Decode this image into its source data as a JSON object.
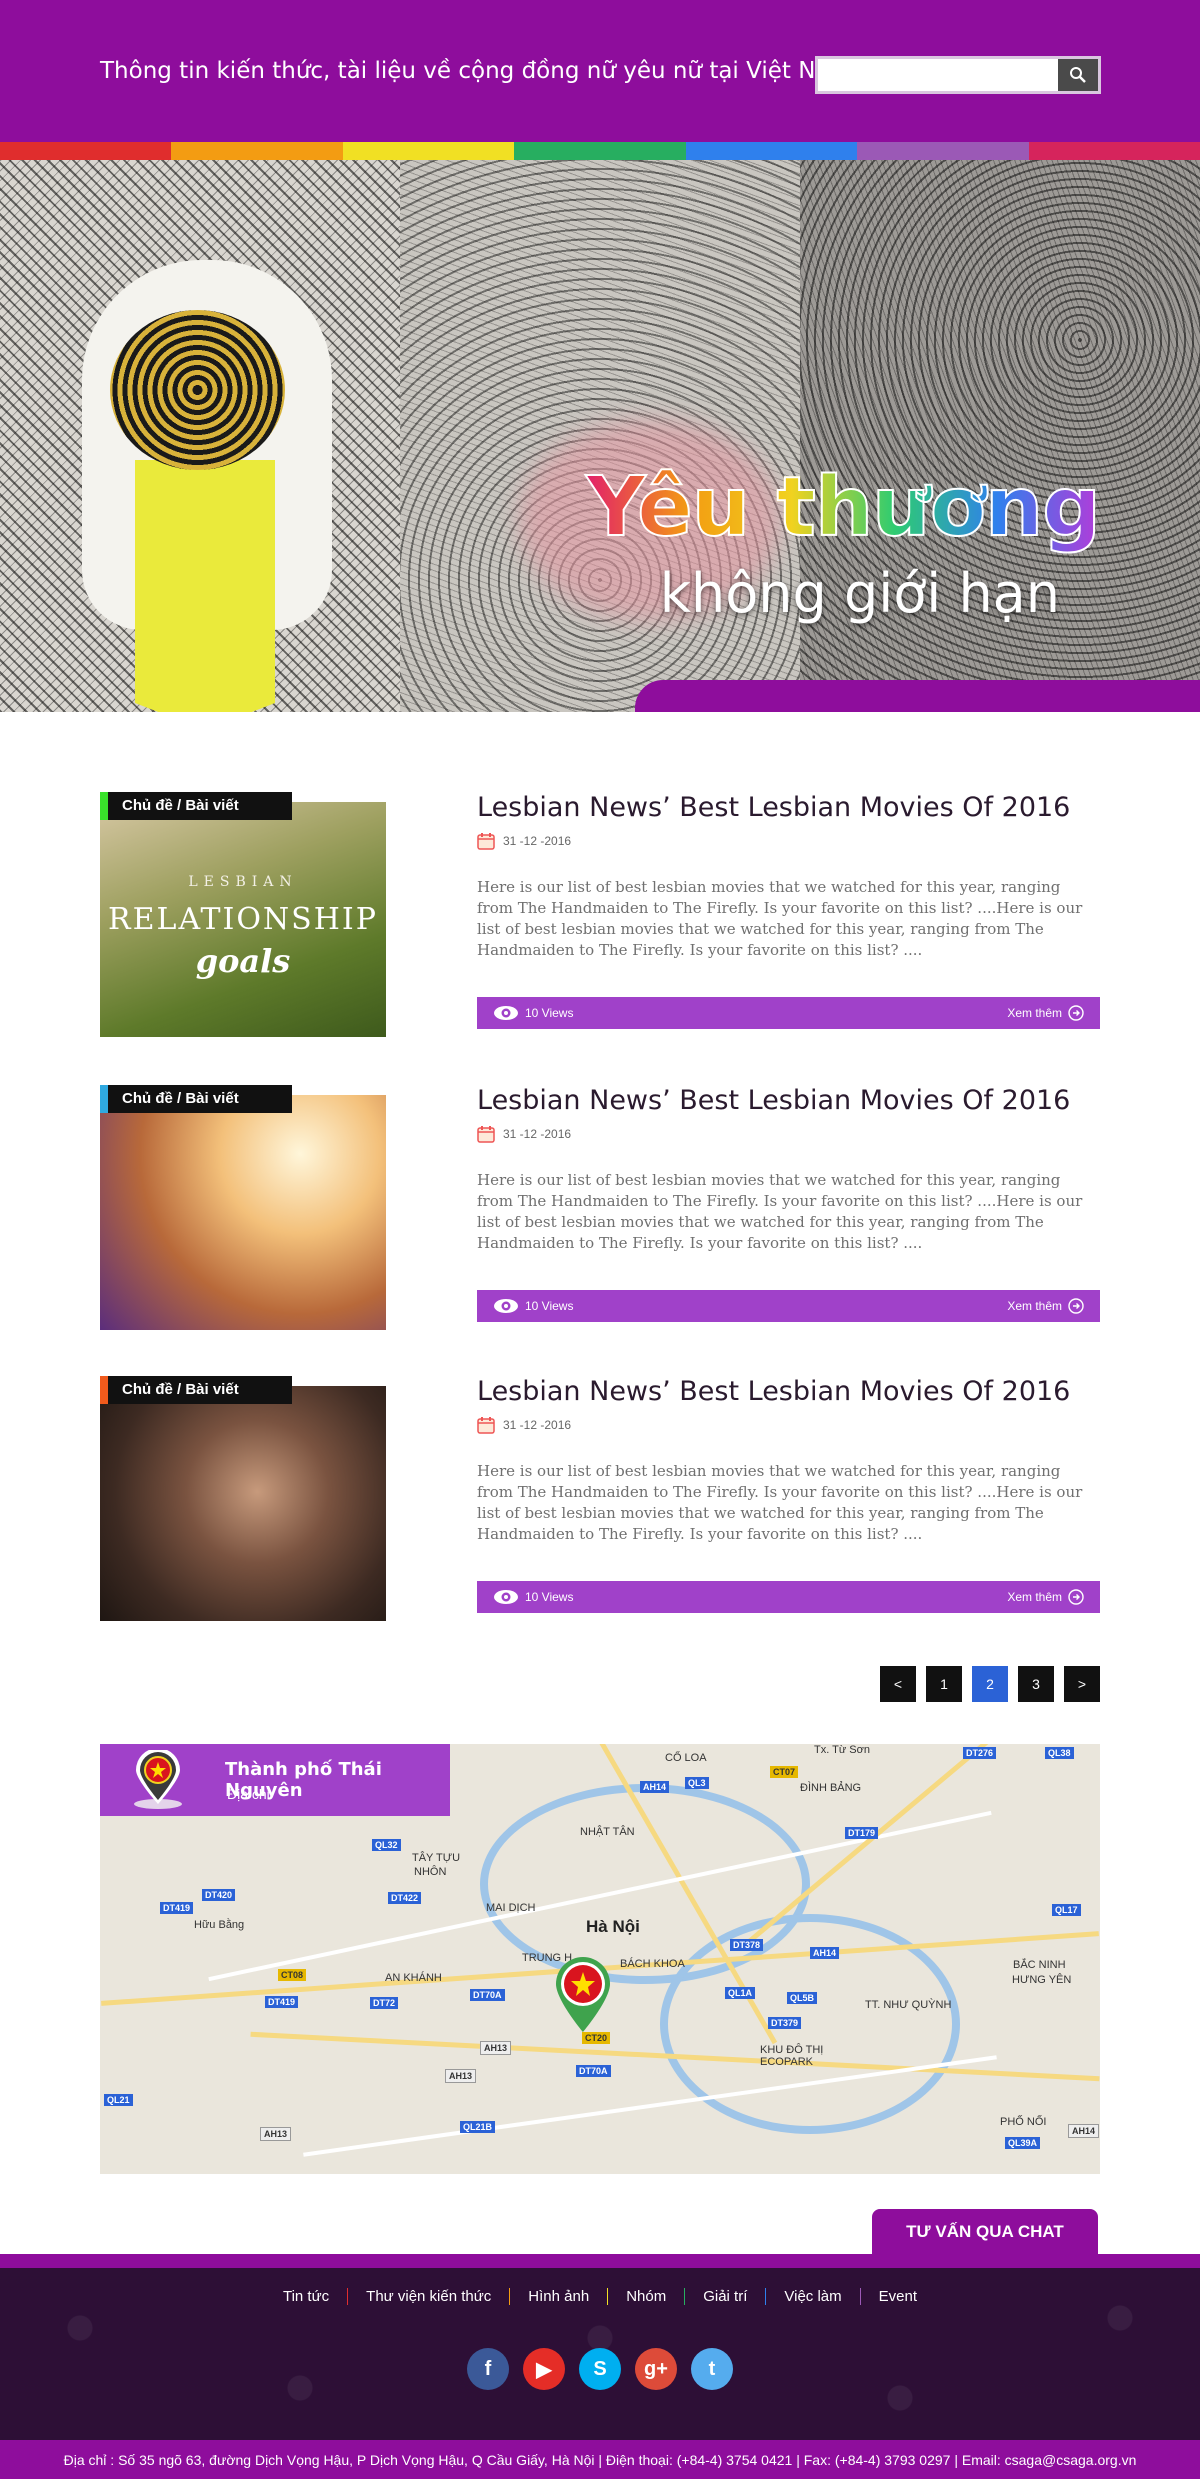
{
  "header": {
    "tagline": "Thông tin kiến thức, tài liệu về cộng đồng nữ yêu nữ tại Việt Nam",
    "search_placeholder": "",
    "search_icon": "search-icon"
  },
  "rainbow_colors": [
    "#e02d2d",
    "#f39c12",
    "#f1e023",
    "#27ae60",
    "#2f80ed",
    "#9b59b6",
    "#d6245c"
  ],
  "hero": {
    "title": "Yêu thương",
    "subtitle": "không giới hạn"
  },
  "articles": [
    {
      "category": "Chủ đề / Bài viết",
      "accent": "#39e12b",
      "image_words": {
        "pre": "LESBIAN",
        "main": "RELATIONSHIP",
        "script": "goals"
      },
      "title": "Lesbian News’ Best Lesbian Movies Of 2016",
      "date": "31 -12 -2016",
      "excerpt": "Here is our list of best lesbian movies that we watched for this year, ranging from The Handmaiden to The Firefly. Is your favorite on this list? ....Here is our list of best lesbian movies that we watched for this year, ranging from The Handmaiden to The Firefly. Is your favorite on this list? ....",
      "views": "10 Views",
      "more": "Xem thêm"
    },
    {
      "category": "Chủ đề / Bài viết",
      "accent": "#2fa9e0",
      "title": "Lesbian News’ Best Lesbian Movies Of 2016",
      "date": "31 -12 -2016",
      "excerpt": "Here is our list of best lesbian movies that we watched for this year, ranging from The Handmaiden to The Firefly. Is your favorite on this list? ....Here is our list of best lesbian movies that we watched for this year, ranging from The Handmaiden to The Firefly. Is your favorite on this list? ....",
      "views": "10 Views",
      "more": "Xem thêm"
    },
    {
      "category": "Chủ đề / Bài viết",
      "accent": "#f05a1c",
      "title": "Lesbian News’ Best Lesbian Movies Of 2016",
      "date": "31 -12 -2016",
      "excerpt": "Here is our list of best lesbian movies that we watched for this year, ranging from The Handmaiden to The Firefly. Is your favorite on this list? ....Here is our list of best lesbian movies that we watched for this year, ranging from The Handmaiden to The Firefly. Is your favorite on this list? ....",
      "views": "10 Views",
      "more": "Xem thêm"
    }
  ],
  "pagination": {
    "prev": "<",
    "pages": [
      "1",
      "2",
      "3"
    ],
    "active": "2",
    "next": ">"
  },
  "map": {
    "city": "Thành phố Thái Nguyên",
    "address_label": "Địa chỉ",
    "center_label": "Hà Nội",
    "labels": [
      "Tx. Từ Sơn",
      "CỔ LOA",
      "ĐÌNH BẢNG",
      "NHẬT TÂN",
      "TÂY TỰU",
      "NHÔN",
      "Hữu Bằng",
      "MAI DỊCH",
      "TRUNG H",
      "BÁCH KHOA",
      "AN KHÁNH",
      "TT. NHƯ QUỲNH",
      "BẮC NINH",
      "HƯNG YÊN",
      "KHU ĐÔ THỊ ECOPARK",
      "PHỐ NỐI"
    ],
    "road_tags": [
      "AH14",
      "QL3",
      "CT07",
      "DT276",
      "QL38",
      "DT179",
      "QL32",
      "DT420",
      "DT419",
      "DT422",
      "QL17",
      "DT378",
      "AH14",
      "CT08",
      "DT419",
      "DT72",
      "DT70A",
      "QL1A",
      "QL5B",
      "AH13",
      "DT379",
      "AH13",
      "DT70A",
      "QL21",
      "QL21B",
      "AH13",
      "QL39A",
      "AH14",
      "CT20"
    ]
  },
  "chat": {
    "label": "TƯ VẤN QUA CHAT"
  },
  "footer": {
    "nav": [
      "Tin tức",
      "Thư viện kiến thức",
      "Hình ảnh",
      "Nhóm",
      "Giải trí",
      "Việc làm",
      "Event"
    ],
    "nav_separator_colors": [
      "#e02d2d",
      "#f39c12",
      "#f1e023",
      "#27ae60",
      "#2f80ed",
      "#9b59b6"
    ],
    "socials": [
      {
        "name": "facebook-icon",
        "glyph": "f",
        "color": "#3b5998"
      },
      {
        "name": "youtube-icon",
        "glyph": "▶",
        "color": "#e52d27"
      },
      {
        "name": "skype-icon",
        "glyph": "S",
        "color": "#00aff0"
      },
      {
        "name": "google-plus-icon",
        "glyph": "g+",
        "color": "#dd4b39"
      },
      {
        "name": "twitter-icon",
        "glyph": "t",
        "color": "#55acee"
      }
    ],
    "address": "Địa chỉ : Số 35 ngõ 63, đường Dịch Vọng Hậu, P Dịch Vọng Hậu, Q Cầu Giấy, Hà Nội  |  Điện thoại: (+84-4) 3754 0421  |  Fax: (+84-4) 3793 0297  |  Email: csaga@csaga.org.vn"
  }
}
